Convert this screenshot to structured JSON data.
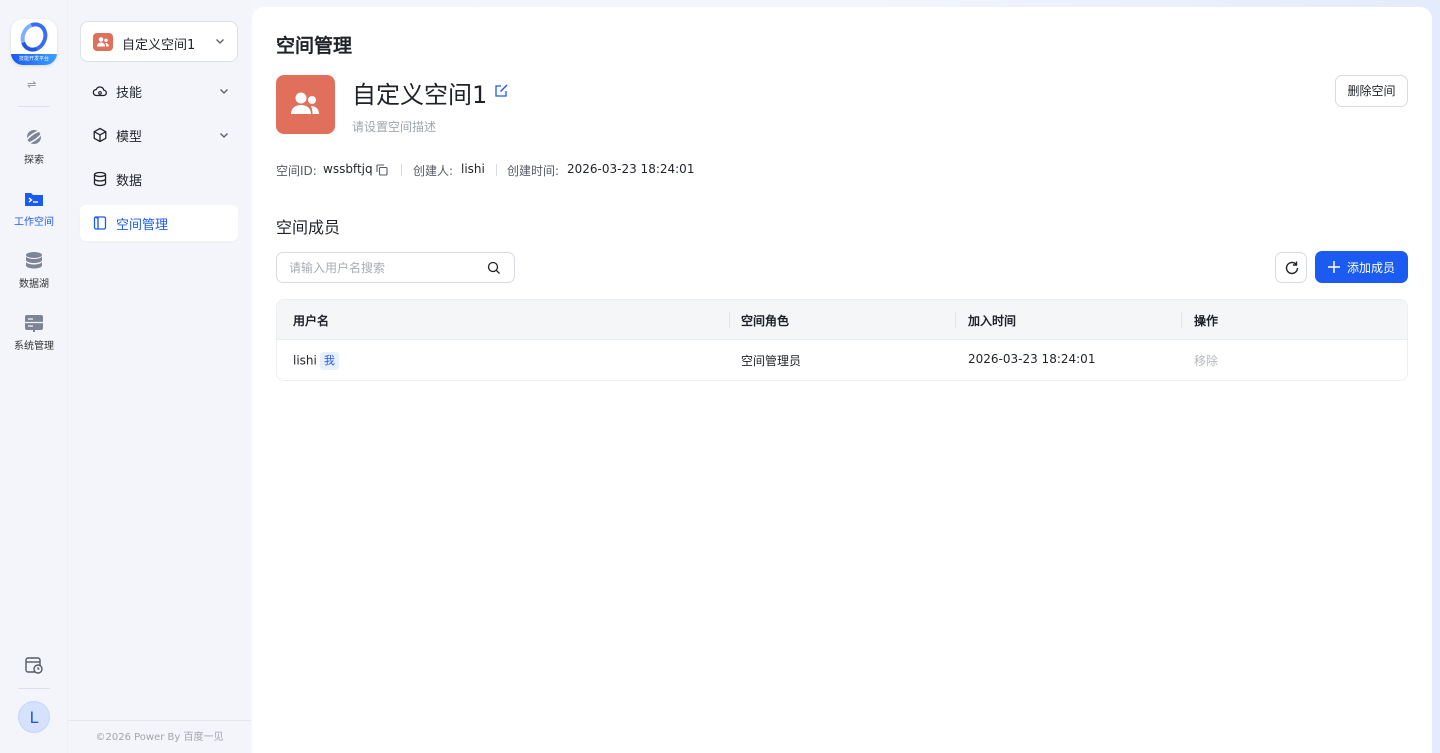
{
  "rail": {
    "logo_caption": "技能开发平台",
    "items": [
      {
        "label": "探索",
        "icon": "planet-icon"
      },
      {
        "label": "工作空间",
        "icon": "terminal-folder-icon"
      },
      {
        "label": "数据湖",
        "icon": "database-icon"
      },
      {
        "label": "系统管理",
        "icon": "server-icon"
      }
    ],
    "user_initial": "L"
  },
  "sidebar": {
    "space_selector": "自定义空间1",
    "items": [
      {
        "label": "技能",
        "icon": "skill-cloud-icon",
        "expandable": true
      },
      {
        "label": "模型",
        "icon": "cube-icon",
        "expandable": true
      },
      {
        "label": "数据",
        "icon": "database-icon",
        "expandable": false
      },
      {
        "label": "空间管理",
        "icon": "space-book-icon",
        "expandable": false,
        "active": true
      }
    ],
    "footer": "©2026 Power By 百度一见"
  },
  "main": {
    "page_title": "空间管理",
    "space_name": "自定义空间1",
    "space_desc_placeholder": "请设置空间描述",
    "delete_label": "删除空间",
    "meta": {
      "id_label": "空间ID:",
      "id_value": "wssbftjq",
      "creator_label": "创建人:",
      "creator_value": "lishi",
      "created_label": "创建时间:",
      "created_value": "2026-03-23 18:24:01"
    },
    "members_title": "空间成员",
    "search_placeholder": "请输入用户名搜索",
    "add_member_label": "添加成员",
    "table": {
      "columns": [
        "用户名",
        "空间角色",
        "加入时间",
        "操作"
      ],
      "rows": [
        {
          "username": "lishi",
          "badge": "我",
          "role": "空间管理员",
          "joined": "2026-03-23 18:24:01",
          "action": "移除"
        }
      ]
    }
  },
  "colors": {
    "accent": "#1c5bf2",
    "space_avatar": "#e06f5c"
  }
}
